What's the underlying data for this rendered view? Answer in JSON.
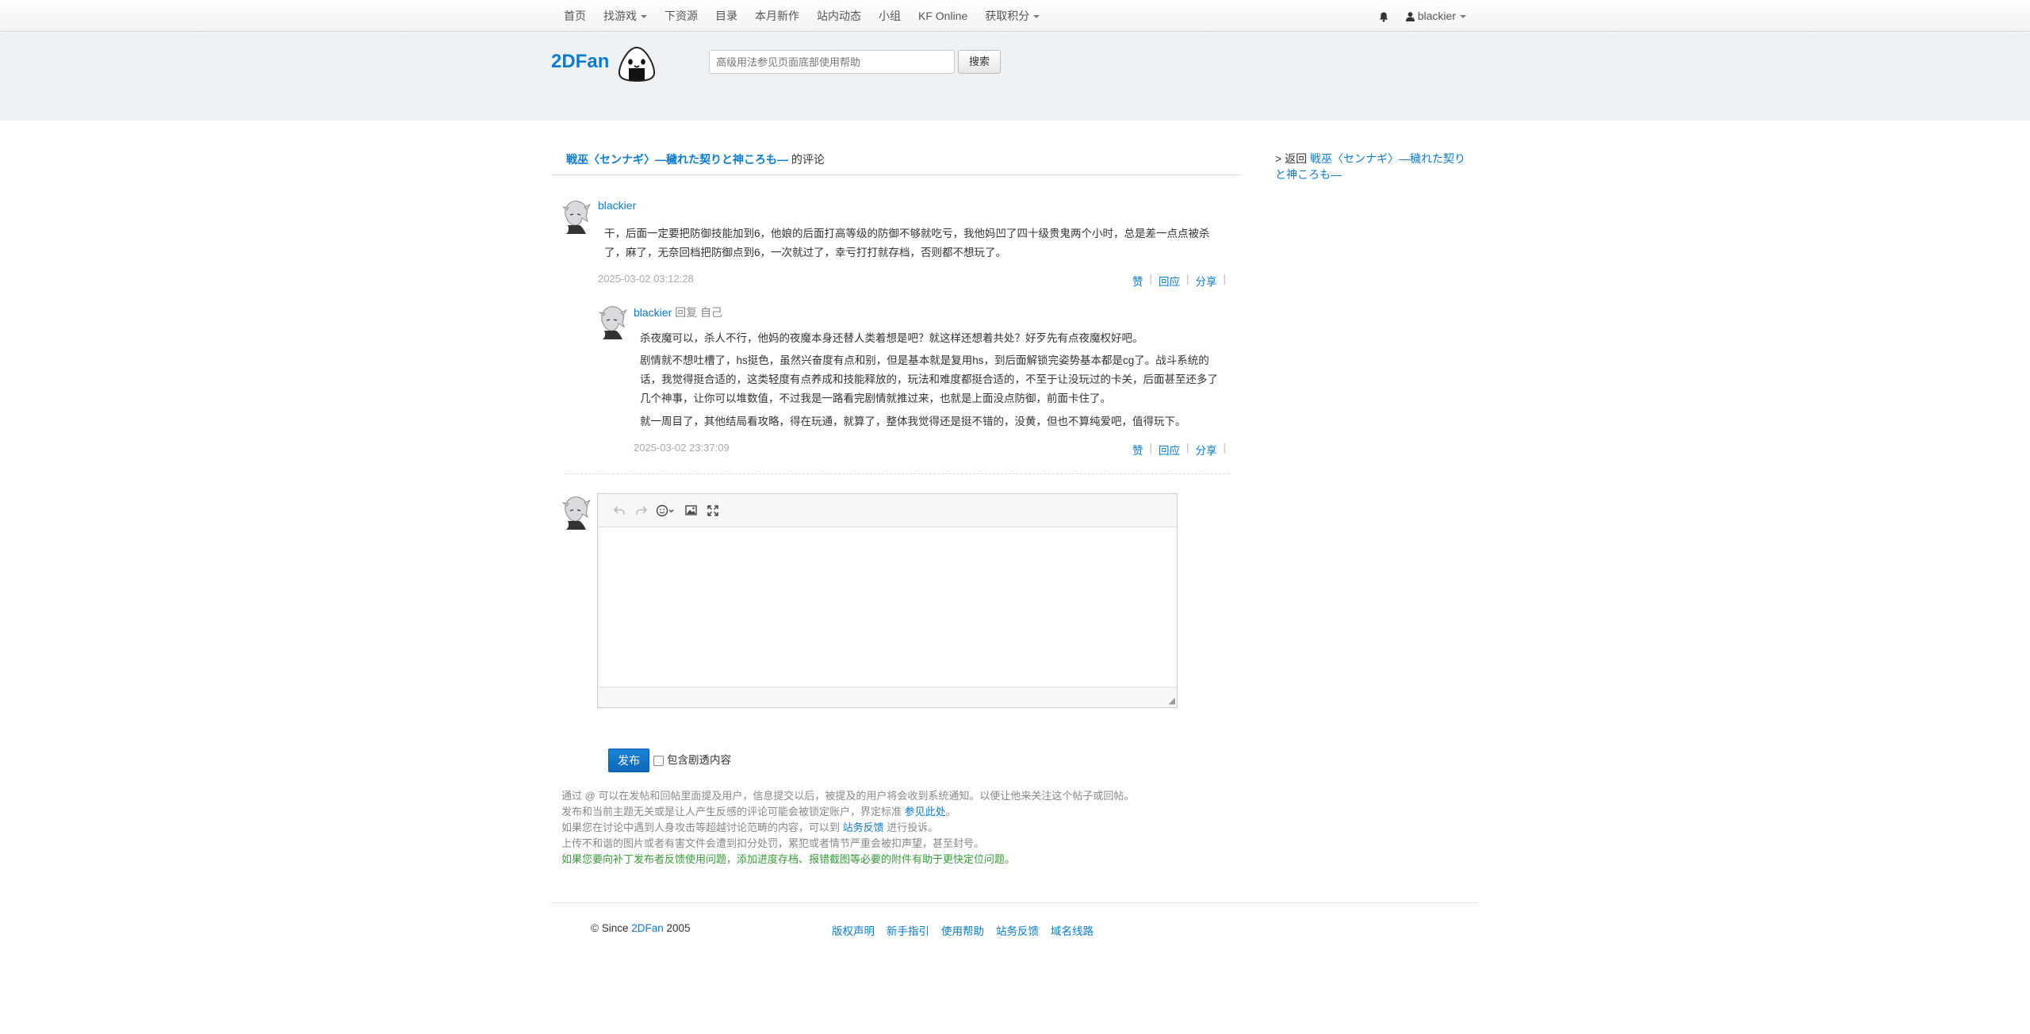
{
  "nav": {
    "items": [
      {
        "label": "首页",
        "caret": false
      },
      {
        "label": "找游戏",
        "caret": true
      },
      {
        "label": "下资源",
        "caret": false
      },
      {
        "label": "目录",
        "caret": false
      },
      {
        "label": "本月新作",
        "caret": false
      },
      {
        "label": "站内动态",
        "caret": false
      },
      {
        "label": "小组",
        "caret": false
      },
      {
        "label": "KF Online",
        "caret": false
      },
      {
        "label": "获取积分",
        "caret": true
      }
    ],
    "user": "blackier"
  },
  "header": {
    "logo": "2DFan",
    "search_placeholder": "高级用法参见页面底部使用帮助",
    "search_button": "搜索"
  },
  "page": {
    "game_title": "戦巫〈センナギ〉—穢れた契りと神ころも—",
    "heading_suffix": " 的评论"
  },
  "comment": {
    "user": "blackier",
    "text": "干，后面一定要把防御技能加到6，他娘的后面打高等级的防御不够就吃亏，我他妈凹了四十级贵鬼两个小时，总是差一点点被杀了，麻了，无奈回档把防御点到6，一次就过了，幸亏打打就存档，否则都不想玩了。",
    "date": "2025-03-02 03:12:28",
    "actions": [
      "赞",
      "回应",
      "分享"
    ]
  },
  "reply": {
    "user": "blackier",
    "meta": " 回复 自己",
    "paragraphs": [
      "杀夜魔可以，杀人不行，他妈的夜魔本身还替人类着想是吧？就这样还想着共处？好歹先有点夜魔权好吧。",
      "剧情就不想吐槽了，hs挺色，虽然兴奋度有点和别，但是基本就是复用hs，到后面解锁完姿势基本都是cg了。战斗系统的话，我觉得挺合适的，这类轻度有点养成和技能释放的，玩法和难度都挺合适的，不至于让没玩过的卡关，后面甚至还多了几个神事，让你可以堆数值，不过我是一路看完剧情就推过来，也就是上面没点防御，前面卡住了。",
      "就一周目了，其他结局看攻略，得在玩通，就算了，整体我觉得还是挺不错的，没黄，但也不算纯爱吧，值得玩下。"
    ],
    "date": "2025-03-02 23:37:09",
    "actions": [
      "赞",
      "回应",
      "分享"
    ]
  },
  "editor": {
    "toolbar": [
      "undo-icon",
      "redo-icon",
      "emoji-icon",
      "image-icon",
      "fullscreen-icon"
    ]
  },
  "publish": {
    "button": "发布",
    "spoiler_label": "包含剧透内容"
  },
  "notes": {
    "line1": "通过 @ 可以在发帖和回帖里面提及用户，信息提交以后，被提及的用户将会收到系统通知。以便让他来关注这个帖子或回帖。",
    "line2_a": "发布和当前主题无关或是让人产生反感的评论可能会被锁定账户，界定标准 ",
    "line2_link": "参见此处",
    "line2_b": "。",
    "line3_a": "如果您在讨论中遇到人身攻击等超越讨论范畴的内容，可以到 ",
    "line3_link": "站务反馈",
    "line3_b": " 进行投诉。",
    "line4": "上传不和谐的图片或者有害文件会遭到扣分处罚，累犯或者情节严重会被扣声望，甚至封号。",
    "line5": "如果您要向补丁发布者反馈使用问题，添加进度存档、报错截图等必要的附件有助于更快定位问题。"
  },
  "sidebar": {
    "back_prefix": "> 返回 ",
    "back_link": "戦巫〈センナギ〉—穢れた契りと神ころも—"
  },
  "footer": {
    "copy_a": "© Since ",
    "copy_link": "2DFan",
    "copy_b": " 2005",
    "links": [
      "版权声明",
      "新手指引",
      "使用帮助",
      "站务反馈",
      "域名线路"
    ]
  }
}
